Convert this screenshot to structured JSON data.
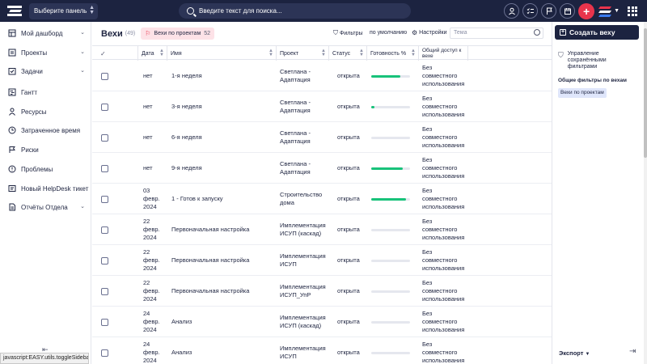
{
  "topbar": {
    "panel_select": "Выберите панель",
    "search_placeholder": "Введите текст для поиска..."
  },
  "sidebar": {
    "items": [
      {
        "label": "Мой дашборд",
        "icon": "dashboard-icon",
        "chevron": true
      },
      {
        "label": "Проекты",
        "icon": "projects-icon",
        "chevron": true
      },
      {
        "label": "Задачи",
        "icon": "tasks-icon",
        "chevron": true
      },
      {
        "label": "Гантт",
        "icon": "gantt-icon",
        "chevron": false
      },
      {
        "label": "Ресурсы",
        "icon": "resources-icon",
        "chevron": false
      },
      {
        "label": "Затраченное время",
        "icon": "clock-icon",
        "chevron": false
      },
      {
        "label": "Риски",
        "icon": "risks-icon",
        "chevron": false
      },
      {
        "label": "Проблемы",
        "icon": "problems-icon",
        "chevron": false
      },
      {
        "label": "Новый HelpDesk тикет",
        "icon": "helpdesk-icon",
        "chevron": false
      },
      {
        "label": "Отчёты Отдела",
        "icon": "reports-icon",
        "chevron": true
      }
    ]
  },
  "statusbar": "javascript:EASY.utils.toggleSidebar();",
  "main": {
    "title": "Вехи",
    "count": "(49)",
    "chip_label": "Вехи по проектам",
    "chip_badge": "52",
    "filters_label": "Фильтры",
    "default_label": "по умолчанию",
    "settings_label": "Настройки",
    "theme_placeholder": "Тема"
  },
  "table": {
    "headers": {
      "date": "Дата",
      "name": "Имя",
      "project": "Проект",
      "status": "Статус",
      "progress": "Готовность %",
      "access": "Общий доступ к вехе"
    },
    "rows": [
      {
        "date": "нет",
        "name": "1-я неделя",
        "project": "Светлана - Адаптация",
        "status": "открыта",
        "progress": 0.75,
        "access": "Без совместного использования"
      },
      {
        "date": "нет",
        "name": "3-я неделя",
        "project": "Светлана - Адаптация",
        "status": "открыта",
        "progress": 0.08,
        "access": "Без совместного использования"
      },
      {
        "date": "нет",
        "name": "6-я неделя",
        "project": "Светлана - Адаптация",
        "status": "открыта",
        "progress": 0,
        "access": "Без совместного использования"
      },
      {
        "date": "нет",
        "name": "9-я неделя",
        "project": "Светлана - Адаптация",
        "status": "открыта",
        "progress": 0.82,
        "access": "Без совместного использования"
      },
      {
        "date": "03 февр. 2024",
        "name": "1 - Готов к запуску",
        "project": "Строительство дома",
        "status": "открыта",
        "progress": 0.9,
        "access": "Без совместного использования"
      },
      {
        "date": "22 февр. 2024",
        "name": "Первоначальная настройка",
        "project": "Имплементация ИСУП (каскад)",
        "status": "открыта",
        "progress": 0,
        "access": "Без совместного использования"
      },
      {
        "date": "22 февр. 2024",
        "name": "Первоначальная настройка",
        "project": "Имплементация ИСУП",
        "status": "открыта",
        "progress": 0,
        "access": "Без совместного использования"
      },
      {
        "date": "22 февр. 2024",
        "name": "Первоначальная настройка",
        "project": "Имплементация ИСУП_УпР",
        "status": "открыта",
        "progress": 0,
        "access": "Без совместного использования"
      },
      {
        "date": "24 февр. 2024",
        "name": "Анализ",
        "project": "Имплементация ИСУП (каскад)",
        "status": "открыта",
        "progress": 0,
        "access": "Без совместного использования"
      },
      {
        "date": "24 февр. 2024",
        "name": "Анализ",
        "project": "Имплементация ИСУП",
        "status": "открыта",
        "progress": 0,
        "access": "Без совместного использования"
      }
    ]
  },
  "rpanel": {
    "create_label": "Создать веху",
    "manage_label": "Управление сохранёнными фильтрами",
    "common_title": "Общие фильтры по вехам",
    "filter_tag": "Вехи по проектам",
    "export_label": "Экспорт"
  },
  "colors": {
    "topbar": "#1c2340",
    "accent_red": "#e8344c",
    "progress_green": "#18c27a",
    "chip_bg": "#fde2e7"
  }
}
